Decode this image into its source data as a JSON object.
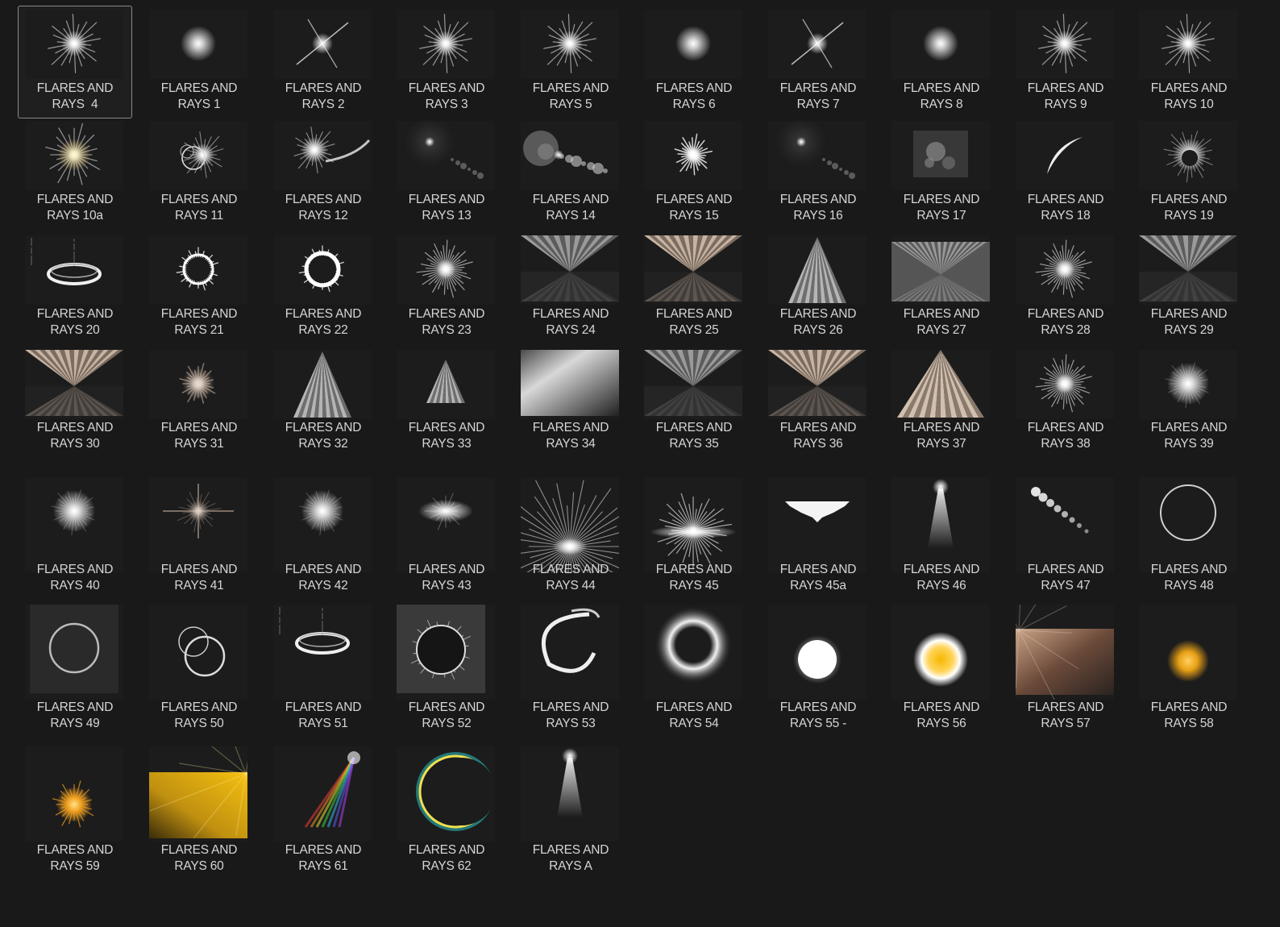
{
  "brushes": [
    {
      "line1": "FLARES AND",
      "line2": "RAYS  4",
      "icon": "star-burst-icon",
      "style": "star",
      "selected": true
    },
    {
      "line1": "FLARES AND",
      "line2": "RAYS 1",
      "icon": "soft-glow-icon",
      "style": "glow"
    },
    {
      "line1": "FLARES AND",
      "line2": "RAYS 2",
      "icon": "cross-flare-icon",
      "style": "cross"
    },
    {
      "line1": "FLARES AND",
      "line2": "RAYS 3",
      "icon": "star-burst-icon",
      "style": "star"
    },
    {
      "line1": "FLARES AND",
      "line2": "RAYS 5",
      "icon": "star-burst-icon",
      "style": "star"
    },
    {
      "line1": "FLARES AND",
      "line2": "RAYS 6",
      "icon": "soft-glow-icon",
      "style": "glow"
    },
    {
      "line1": "FLARES AND",
      "line2": "RAYS 7",
      "icon": "cross-flare-icon",
      "style": "cross"
    },
    {
      "line1": "FLARES AND",
      "line2": "RAYS 8",
      "icon": "soft-glow-icon",
      "style": "glow"
    },
    {
      "line1": "FLARES AND",
      "line2": "RAYS 9",
      "icon": "star-burst-icon",
      "style": "star"
    },
    {
      "line1": "FLARES AND",
      "line2": "RAYS 10",
      "icon": "star-burst-icon",
      "style": "star"
    },
    {
      "line1": "FLARES AND",
      "line2": "RAYS 10a",
      "icon": "warm-star-icon",
      "style": "warmstar"
    },
    {
      "line1": "FLARES AND",
      "line2": "RAYS 11",
      "icon": "ring-flare-icon",
      "style": "ringflare"
    },
    {
      "line1": "FLARES AND",
      "line2": "RAYS 12",
      "icon": "arc-flare-icon",
      "style": "arcflare"
    },
    {
      "line1": "FLARES AND",
      "line2": "RAYS 13",
      "icon": "lens-flare-icon",
      "style": "lens"
    },
    {
      "line1": "FLARES AND",
      "line2": "RAYS 14",
      "icon": "lens-flare-icon",
      "style": "lens2"
    },
    {
      "line1": "FLARES AND",
      "line2": "RAYS 15",
      "icon": "spark-icon",
      "style": "spark"
    },
    {
      "line1": "FLARES AND",
      "line2": "RAYS 16",
      "icon": "lens-flare-icon",
      "style": "lens"
    },
    {
      "line1": "FLARES AND",
      "line2": "RAYS 17",
      "icon": "bokeh-icon",
      "style": "bokeh"
    },
    {
      "line1": "FLARES AND",
      "line2": "RAYS 18",
      "icon": "crescent-icon",
      "style": "crescent"
    },
    {
      "line1": "FLARES AND",
      "line2": "RAYS 19",
      "icon": "eclipse-rays-icon",
      "style": "eclipse"
    },
    {
      "line1": "FLARES AND",
      "line2": "RAYS 20",
      "icon": "halo-ring-icon",
      "style": "halo"
    },
    {
      "line1": "FLARES AND",
      "line2": "RAYS 21",
      "icon": "spiky-ring-icon",
      "style": "spikyring"
    },
    {
      "line1": "FLARES AND",
      "line2": "RAYS 22",
      "icon": "spiky-ring-icon",
      "style": "spikyring2"
    },
    {
      "line1": "FLARES AND",
      "line2": "RAYS 23",
      "icon": "radial-burst-icon",
      "style": "burst"
    },
    {
      "line1": "FLARES AND",
      "line2": "RAYS 24",
      "icon": "ray-fan-icon",
      "style": "fan"
    },
    {
      "line1": "FLARES AND",
      "line2": "RAYS 25",
      "icon": "ray-fan-icon",
      "style": "fanwarm"
    },
    {
      "line1": "FLARES AND",
      "line2": "RAYS 26",
      "icon": "ray-pyramid-icon",
      "style": "pyramid"
    },
    {
      "line1": "FLARES AND",
      "line2": "RAYS 27",
      "icon": "ray-fan-icon",
      "style": "fanstrong"
    },
    {
      "line1": "FLARES AND",
      "line2": "RAYS 28",
      "icon": "radial-burst-icon",
      "style": "burst"
    },
    {
      "line1": "FLARES AND",
      "line2": "RAYS 29",
      "icon": "ray-fan-icon",
      "style": "fan"
    },
    {
      "line1": "FLARES AND",
      "line2": "RAYS 30",
      "icon": "ray-fan-icon",
      "style": "fanwarm"
    },
    {
      "line1": "FLARES AND",
      "line2": "RAYS 31",
      "icon": "warm-burst-icon",
      "style": "warmburst"
    },
    {
      "line1": "FLARES AND",
      "line2": "RAYS 32",
      "icon": "ray-pyramid-icon",
      "style": "pyramid"
    },
    {
      "line1": "FLARES AND",
      "line2": "RAYS 33",
      "icon": "ray-pyramid-icon",
      "style": "pyramidsmall"
    },
    {
      "line1": "FLARES AND",
      "line2": "RAYS 34",
      "icon": "light-beam-icon",
      "style": "beam"
    },
    {
      "line1": "FLARES AND",
      "line2": "RAYS 35",
      "icon": "ray-fan-icon",
      "style": "fan"
    },
    {
      "line1": "FLARES AND",
      "line2": "RAYS 36",
      "icon": "ray-fan-icon",
      "style": "fanwarm"
    },
    {
      "line1": "FLARES AND",
      "line2": "RAYS 37",
      "icon": "ray-pyramid-icon",
      "style": "pyramidwarm"
    },
    {
      "line1": "FLARES AND",
      "line2": "RAYS 38",
      "icon": "radial-burst-icon",
      "style": "burst"
    },
    {
      "line1": "FLARES AND",
      "line2": "RAYS 39",
      "icon": "soft-glow-icon",
      "style": "glowbig"
    },
    {
      "line1": "FLARES AND",
      "line2": "RAYS 40",
      "icon": "soft-glow-icon",
      "style": "glowbig"
    },
    {
      "line1": "FLARES AND",
      "line2": "RAYS 41",
      "icon": "warm-burst-icon",
      "style": "warmcross"
    },
    {
      "line1": "FLARES AND",
      "line2": "RAYS 42",
      "icon": "soft-glow-icon",
      "style": "glowbig"
    },
    {
      "line1": "FLARES AND",
      "line2": "RAYS 43",
      "icon": "star-burst-icon",
      "style": "glowflat"
    },
    {
      "line1": "FLARES AND",
      "line2": "RAYS 44",
      "icon": "upward-rays-icon",
      "style": "uprays"
    },
    {
      "line1": "FLARES AND",
      "line2": "RAYS 45",
      "icon": "upward-rays-icon",
      "style": "horizon"
    },
    {
      "line1": "FLARES AND",
      "line2": "RAYS 45a",
      "icon": "spike-band-icon",
      "style": "band"
    },
    {
      "line1": "FLARES AND",
      "line2": "RAYS 46",
      "icon": "spotlight-icon",
      "style": "spot"
    },
    {
      "line1": "FLARES AND",
      "line2": "RAYS 47",
      "icon": "bokeh-trail-icon",
      "style": "trail"
    },
    {
      "line1": "FLARES AND",
      "line2": "RAYS 48",
      "icon": "thin-ring-icon",
      "style": "thinring"
    },
    {
      "line1": "FLARES AND",
      "line2": "RAYS 49",
      "icon": "thin-ring-icon",
      "style": "ringbox"
    },
    {
      "line1": "FLARES AND",
      "line2": "RAYS 50",
      "icon": "double-ring-icon",
      "style": "doublering"
    },
    {
      "line1": "FLARES AND",
      "line2": "RAYS 51",
      "icon": "halo-ring-icon",
      "style": "halo2"
    },
    {
      "line1": "FLARES AND",
      "line2": "RAYS 52",
      "icon": "eclipse-ring-icon",
      "style": "eclipsebox"
    },
    {
      "line1": "FLARES AND",
      "line2": "RAYS 53",
      "icon": "swirl-ring-icon",
      "style": "swirl"
    },
    {
      "line1": "FLARES AND",
      "line2": "RAYS 54",
      "icon": "glow-ring-icon",
      "style": "glowring"
    },
    {
      "line1": "FLARES AND",
      "line2": "RAYS 55 -",
      "icon": "white-sun-icon",
      "style": "whitesun"
    },
    {
      "line1": "FLARES AND",
      "line2": "RAYS 56",
      "icon": "yellow-sun-icon",
      "style": "yellowsun"
    },
    {
      "line1": "FLARES AND",
      "line2": "RAYS 57",
      "icon": "warm-rays-icon",
      "style": "warmrays"
    },
    {
      "line1": "FLARES AND",
      "line2": "RAYS 58",
      "icon": "orange-glow-icon",
      "style": "orangeglow"
    },
    {
      "line1": "FLARES AND",
      "line2": "RAYS 59",
      "icon": "orange-star-icon",
      "style": "orangestar"
    },
    {
      "line1": "FLARES AND",
      "line2": "RAYS 60",
      "icon": "yellow-rays-icon",
      "style": "yellowrays"
    },
    {
      "line1": "FLARES AND",
      "line2": "RAYS 61",
      "icon": "rainbow-flare-icon",
      "style": "rainbow"
    },
    {
      "line1": "FLARES AND",
      "line2": "RAYS 62",
      "icon": "rainbow-ring-icon",
      "style": "rainbowring"
    },
    {
      "line1": "FLARES AND",
      "line2": "RAYS A",
      "icon": "spotlight-icon",
      "style": "spot2"
    }
  ],
  "colors": {
    "background": "#191919",
    "label": "#d6d6d6",
    "selection_border": "#8a8a8a",
    "warm_tint": "#b8a08a",
    "gold": "#f5c010"
  }
}
